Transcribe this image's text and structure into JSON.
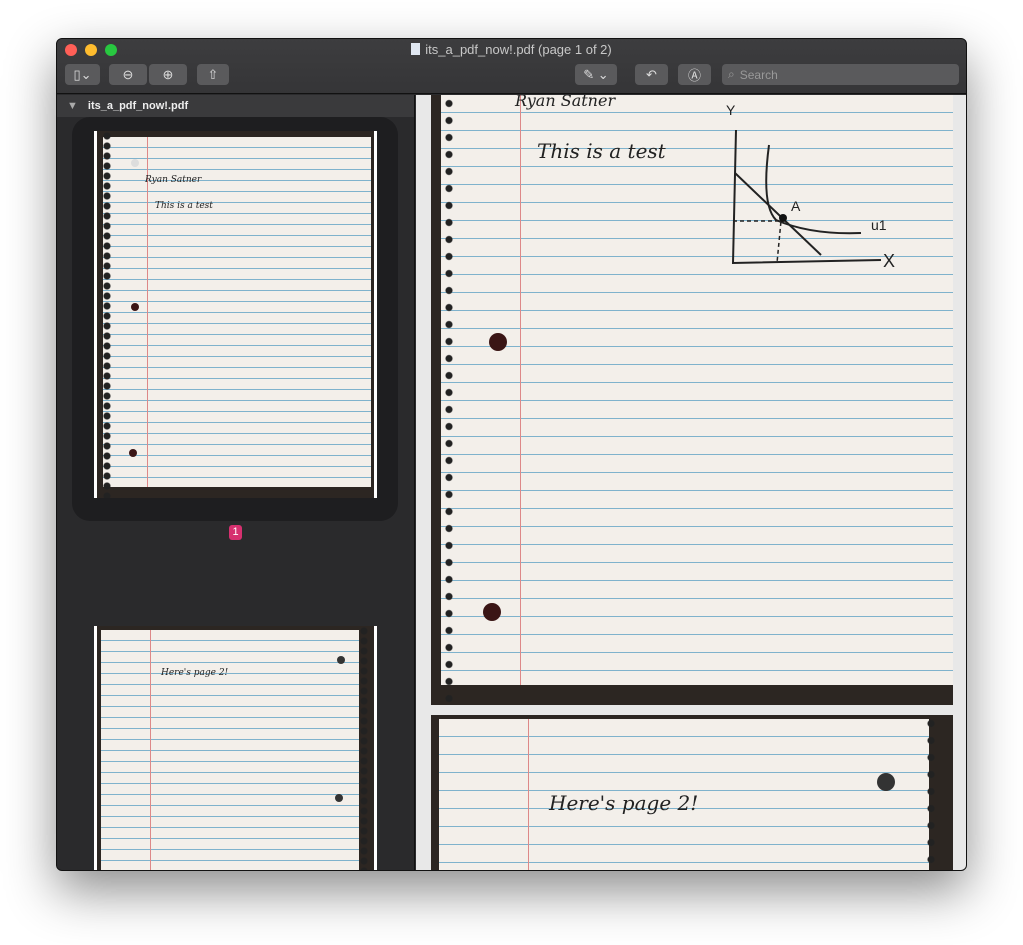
{
  "window": {
    "title": "its_a_pdf_now!.pdf (page 1 of 2)"
  },
  "toolbar": {
    "sidebar_icon": "sidebar-icon",
    "zoom_out_icon": "zoom-out-icon",
    "zoom_in_icon": "zoom-in-icon",
    "share_icon": "share-icon",
    "markup_icon": "pen-icon",
    "rotate_icon": "rotate-icon",
    "annotate_icon": "markup-circle-icon",
    "search_placeholder": "Search"
  },
  "sidebar": {
    "file_name": "its_a_pdf_now!.pdf",
    "selected_page": "1"
  },
  "pages": [
    {
      "name": "Ryan Satner",
      "text": "This is a test",
      "graph": {
        "y": "Y",
        "x": "X",
        "point": "A",
        "curve": "u1"
      }
    },
    {
      "text": "Here's page 2!"
    }
  ],
  "colors": {
    "close": "#ff5f57",
    "minimize": "#febc2e",
    "zoom": "#28c840",
    "badge": "#d6306f"
  }
}
